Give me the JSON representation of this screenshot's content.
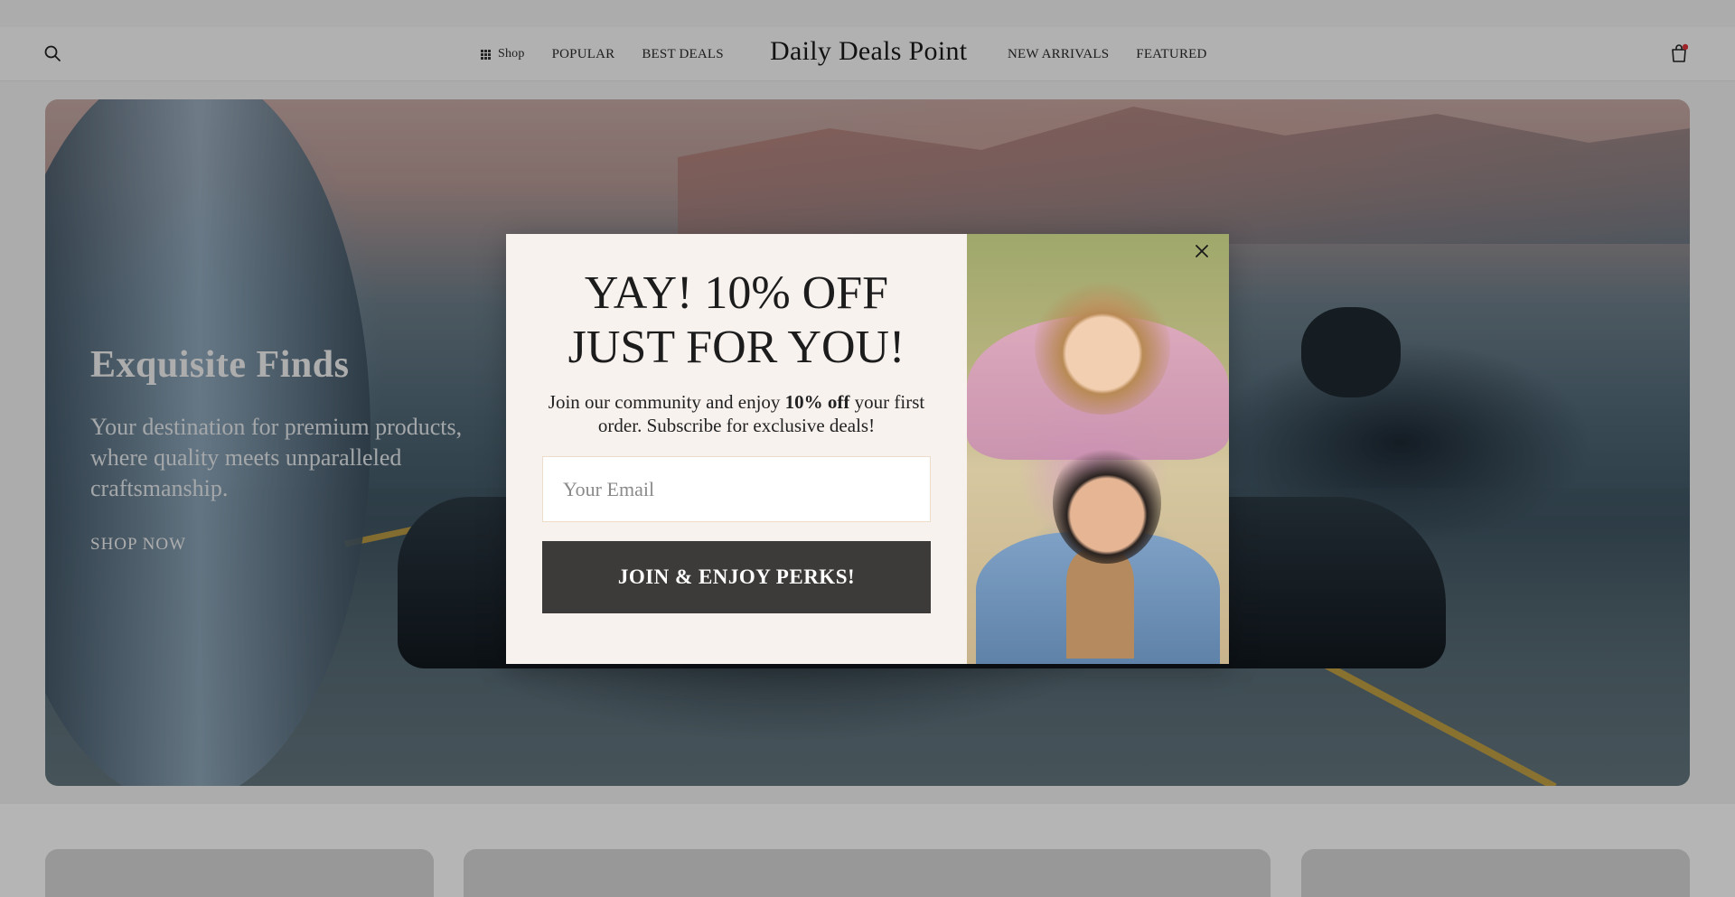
{
  "header": {
    "brand": "Daily Deals Point",
    "nav_left": [
      {
        "label": "Shop",
        "icon": "grid-icon"
      },
      {
        "label": "POPULAR"
      },
      {
        "label": "BEST DEALS"
      }
    ],
    "nav_right": [
      {
        "label": "NEW ARRIVALS"
      },
      {
        "label": "FEATURED"
      }
    ],
    "search_icon": "search-icon",
    "cart_icon": "shopping-bag-icon",
    "cart_badge_color": "#e0343a"
  },
  "hero": {
    "title": "Exquisite Finds",
    "subtitle": "Your destination for premium products, where quality meets unparalleled craftsmanship.",
    "cta": "SHOP NOW"
  },
  "popup": {
    "title_line1": "YAY! 10% OFF",
    "title_line2": "JUST FOR YOU!",
    "desc_before": "Join our community and enjoy ",
    "desc_bold": "10% off",
    "desc_after": " your first order. Subscribe for exclusive deals!",
    "email_placeholder": "Your Email",
    "email_value": "",
    "join_label": "JOIN & ENJOY PERKS!",
    "close_icon": "close-icon",
    "button_color": "#3c3b39",
    "panel_color": "#f8f2ef"
  }
}
